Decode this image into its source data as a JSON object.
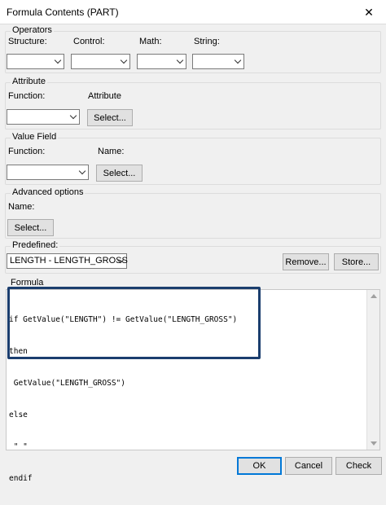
{
  "window": {
    "title": "Formula Contents (PART)",
    "close_glyph": "✕"
  },
  "operators": {
    "title": "Operators",
    "structure_label": "Structure:",
    "control_label": "Control:",
    "math_label": "Math:",
    "string_label": "String:",
    "structure_value": "",
    "control_value": "",
    "math_value": "",
    "string_value": ""
  },
  "attribute": {
    "title": "Attribute",
    "function_label": "Function:",
    "attribute_label": "Attribute",
    "function_value": "",
    "select_label": "Select..."
  },
  "value_field": {
    "title": "Value Field",
    "function_label": "Function:",
    "name_label": "Name:",
    "function_value": "",
    "select_label": "Select..."
  },
  "advanced": {
    "title": "Advanced options",
    "name_label": "Name:",
    "select_label": "Select..."
  },
  "predefined": {
    "title": "Predefined:",
    "value": "LENGTH - LENGTH_GROSS",
    "remove_label": "Remove...",
    "store_label": "Store..."
  },
  "formula": {
    "title": "Formula",
    "lines": [
      "if GetValue(\"LENGTH\") != GetValue(\"LENGTH_GROSS\")",
      "then",
      " GetValue(\"LENGTH_GROSS\")",
      "else",
      " \" \"",
      "endif"
    ]
  },
  "footer": {
    "ok_label": "OK",
    "cancel_label": "Cancel",
    "check_label": "Check"
  },
  "colors": {
    "highlight_border": "#1b3e6e",
    "default_button_border": "#0078d7"
  }
}
